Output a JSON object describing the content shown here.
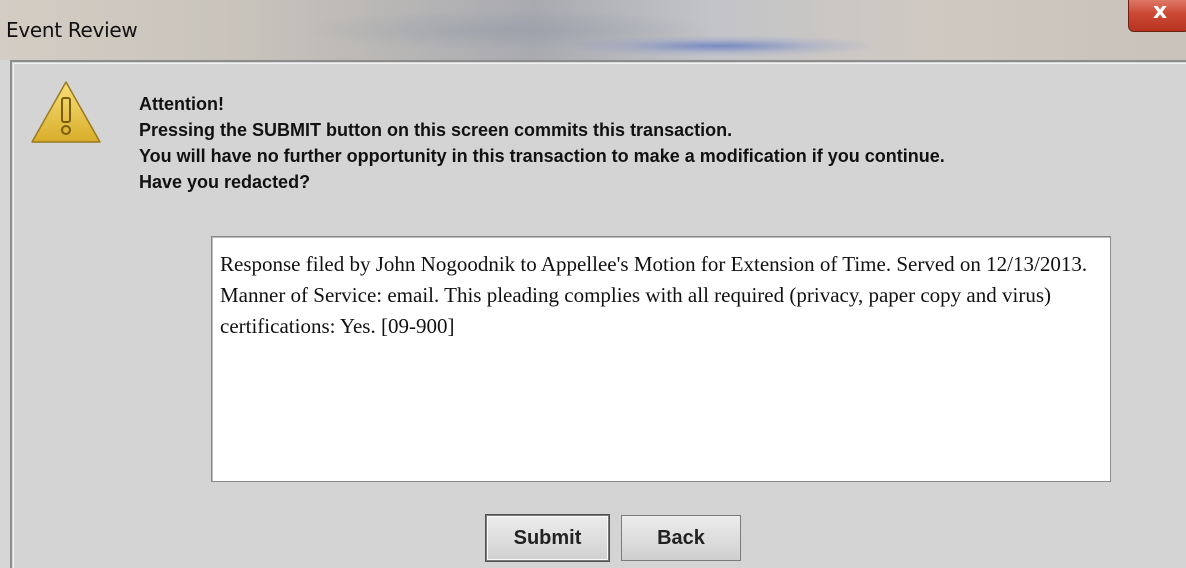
{
  "window": {
    "title": "Event Review",
    "close_glyph": "x"
  },
  "icons": {
    "warning": "warning-triangle-icon"
  },
  "message": {
    "lines": [
      "Attention!",
      "Pressing the SUBMIT button on this screen commits this transaction.",
      "You will have no further opportunity in this transaction to make a modification if you continue.",
      "Have you redacted?"
    ]
  },
  "docket_text": {
    "value": "Response filed by John Nogoodnik to Appellee's Motion for Extension of Time. Served on 12/13/2013. Manner of Service: email. This pleading complies with all required (privacy, paper copy and virus) certifications: Yes. [09-900]"
  },
  "buttons": {
    "submit": "Submit",
    "back": "Back"
  },
  "colors": {
    "dialog_bg": "#d4d4d4",
    "close_red": "#cc4a35",
    "warning_yellow": "#e8c64a"
  }
}
